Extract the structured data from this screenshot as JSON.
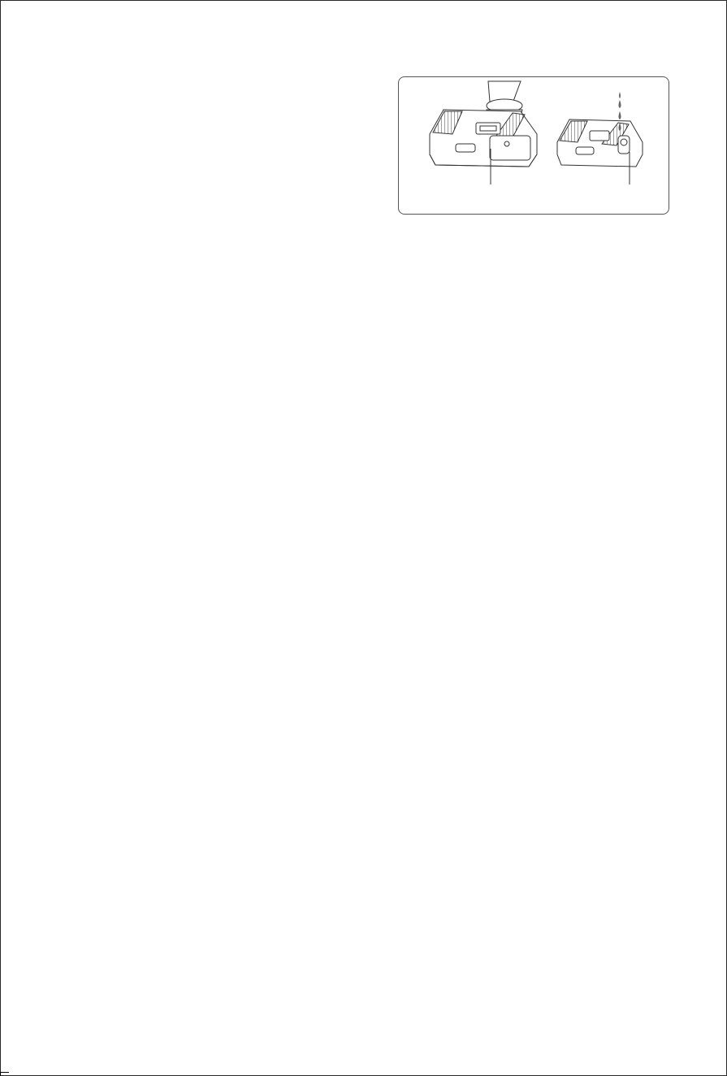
{
  "figure": {
    "illustrations": [
      {
        "name": "nozzle-with-handle",
        "icon": "floor-nozzle-attached-icon"
      },
      {
        "name": "nozzle-with-water-drops",
        "icon": "floor-nozzle-water-icon"
      }
    ],
    "colors": {
      "line": "#333333",
      "border": "#555555",
      "background": "#ffffff"
    }
  }
}
